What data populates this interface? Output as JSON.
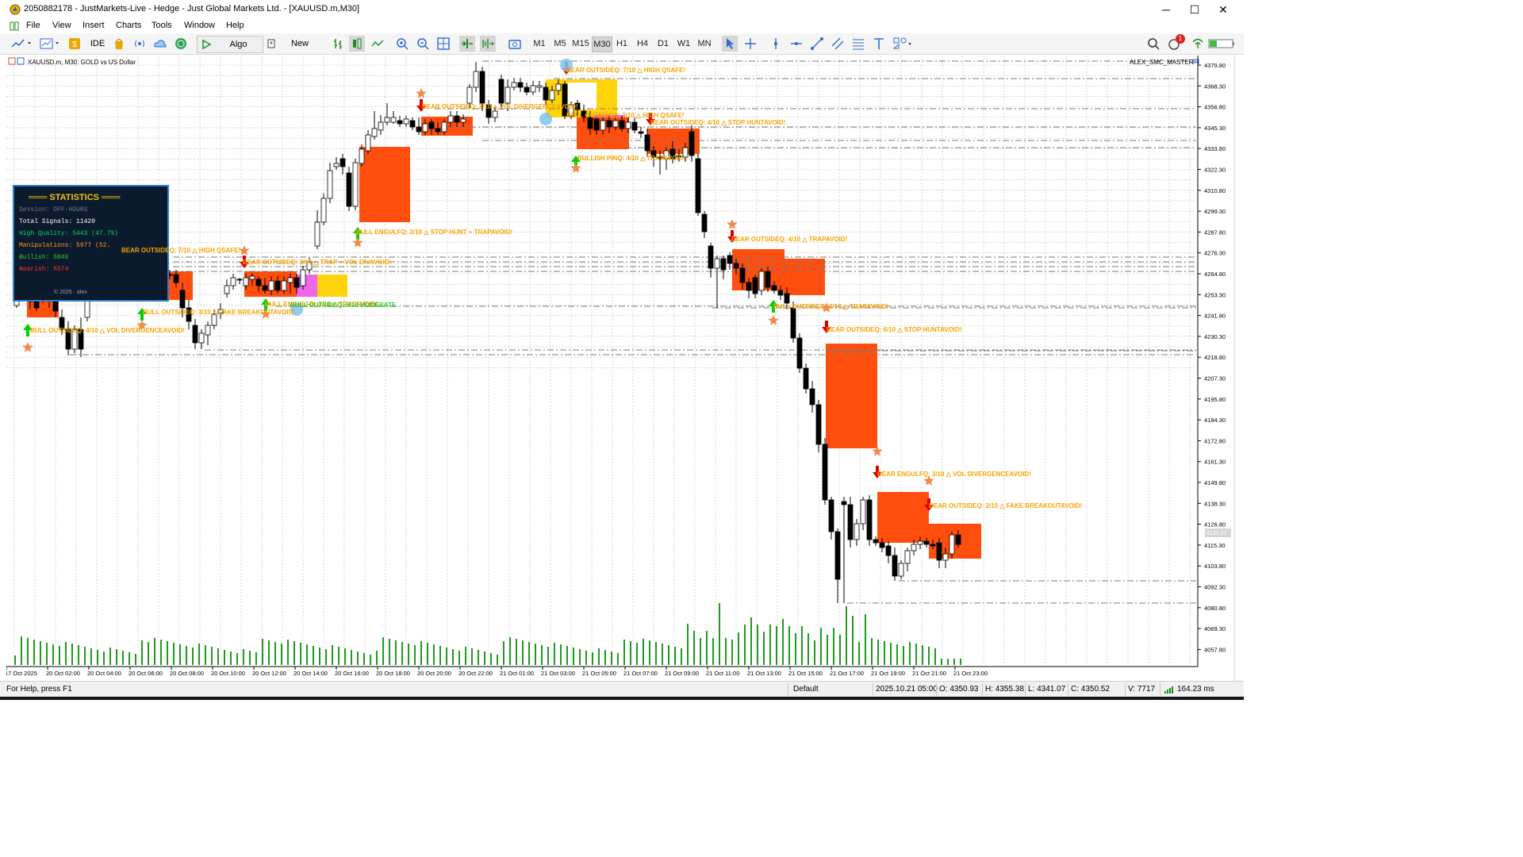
{
  "window": {
    "title": "2050882178 - JustMarkets-Live - Hedge - Just Global Markets Ltd. - [XAUUSD.m,M30]",
    "controls": {
      "minimize": "─",
      "maximize": "☐",
      "close": "✕"
    }
  },
  "menu": [
    "File",
    "View",
    "Insert",
    "Charts",
    "Tools",
    "Window",
    "Help"
  ],
  "toolbar": {
    "ide_label": "IDE",
    "algo_trading_label": "Algo Trading",
    "new_order_label": "New Order",
    "timeframes": [
      "M1",
      "M5",
      "M15",
      "M30",
      "H1",
      "H4",
      "D1",
      "W1",
      "MN"
    ],
    "active_timeframe": "M30",
    "notification_count": "1"
  },
  "chart": {
    "header": "XAUUSD.m, M30:  GOLD vs US Dollar",
    "indicator_name": "ALEX_SMC_MASTER",
    "price_labels": [
      "4379.80",
      "4368.30",
      "4356.80",
      "4345.30",
      "4333.80",
      "4322.30",
      "4310.80",
      "4299.30",
      "4287.80",
      "4276.30",
      "4264.80",
      "4253.30",
      "4241.80",
      "4230.30",
      "4218.80",
      "4207.30",
      "4195.80",
      "4184.30",
      "4172.80",
      "4161.30",
      "4149.80",
      "4138.30",
      "4126.80",
      "4115.30",
      "4103.80",
      "4092.30",
      "4080.80",
      "4069.30",
      "4057.80"
    ],
    "current_price_label": "4120.47",
    "time_labels": [
      "17 Oct 2025",
      "20 Oct 02:00",
      "20 Oct 04:00",
      "20 Oct 06:00",
      "20 Oct 08:00",
      "20 Oct 10:00",
      "20 Oct 12:00",
      "20 Oct 14:00",
      "20 Oct 16:00",
      "20 Oct 18:00",
      "20 Oct 20:00",
      "20 Oct 22:00",
      "21 Oct 01:00",
      "21 Oct 03:00",
      "21 Oct 05:00",
      "21 Oct 07:00",
      "21 Oct 09:00",
      "21 Oct 11:00",
      "21 Oct 13:00",
      "21 Oct 15:00",
      "21 Oct 17:00",
      "21 Oct 19:00",
      "21 Oct 21:00",
      "21 Oct 23:00"
    ],
    "colors": {
      "bull_candle": "#ffffff",
      "bear_candle": "#000000",
      "zone": "#ff4500",
      "zone_yellow": "#ffd200",
      "zone_magenta": "#ee5ee6",
      "volume": "#1f9a1f",
      "signal_text": "#f6a400",
      "bull_signal_text": "#2ecc2e",
      "arrow_up": "#00d000",
      "arrow_down": "#e00000",
      "star": "#f08a4b",
      "dot": "#7ec3f0",
      "grid": "#bdbdbd",
      "level": "#7a7a7a"
    },
    "signals": [
      "BULL OUTSIDEQ: 4/10 △ VOL DIVERGENCEAVOID!",
      "BULL OUTSIDEQ: 3/10 △ FAKE BREAKOUTAVOID!",
      "BEAR OUTSIDEQ: 7/10 △ HIGH QSAFE!",
      "BEAR OUTSIDEQ: 3/10 △ TRAP + VOL DIVAVOID!",
      "BULL ENGULFQ: 3/10 △ TRAPAVOID!",
      "BULL OUTSIDEQ: 5/10 MODERATE",
      "BULL ENGULFQ: 2/10 △ STOP HUNT + TRAPAVOID!",
      "BEAR OUTSIDEQ: 3/10 △ VOL DIVERGENCEAVOID!",
      "BEAR OUTSIDEQ: 7/10 △ HIGH QSAFE!",
      "BULL OUTSIDEQ: 7/10 △ HIGH QSAFE!",
      "BEAR OUTSIDEQ: 4/10 △ STOP HUNTAVOID!",
      "BULLISH PINQ: 4/10 △ TRAPAVOID!",
      "BEAR OUTSIDEQ: 4/10 △ TRAPAVOID!",
      "BULL OUTSIDEQ: 3/10 △ TRAPAVOID!",
      "BEAR OUTSIDEQ: 6/10 △ STOP HUNTAVOID!",
      "BEAR ENGULFQ: 3/10 △ VOL DIVERGENCEAVOID!",
      "BEAR OUTSIDEQ: 2/10 △ FAKE BREAKOUTAVOID!"
    ]
  },
  "stats_panel": {
    "title": "═══ STATISTICS ═══",
    "session": "Session: OFF-HOURS",
    "total": "Total Signals: 11420",
    "high_quality": "High Quality: 5443 (47.7%)",
    "manipulations": "Manipulations: 5977 (52.",
    "bullish": "Bullish: 5846",
    "bearish": "Bearish: 5574",
    "footer": "© 2025 · alex"
  },
  "status_bar": {
    "help": "For Help, press F1",
    "profile": "Default",
    "datetime": "2025.10.21 05:00",
    "open": "O: 4350.93",
    "high": "H: 4355.38",
    "low": "L: 4341.07",
    "close": "C: 4350.52",
    "volume": "V: 7717",
    "ping": "164.23 ms"
  }
}
